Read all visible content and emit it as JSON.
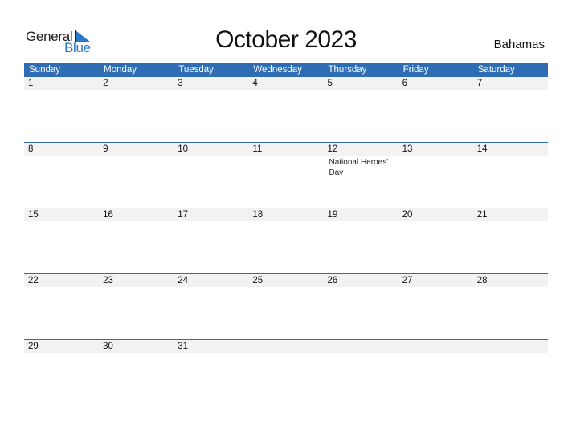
{
  "logo": {
    "part1": "General",
    "part2": "Blue"
  },
  "header": {
    "title": "October 2023",
    "country": "Bahamas"
  },
  "colors": {
    "accent": "#2e6db4",
    "date_strip": "#f2f2f2",
    "logo_blue": "#2a78c8"
  },
  "weekdays": [
    "Sunday",
    "Monday",
    "Tuesday",
    "Wednesday",
    "Thursday",
    "Friday",
    "Saturday"
  ],
  "weeks": [
    {
      "days": [
        {
          "date": "1",
          "event": ""
        },
        {
          "date": "2",
          "event": ""
        },
        {
          "date": "3",
          "event": ""
        },
        {
          "date": "4",
          "event": ""
        },
        {
          "date": "5",
          "event": ""
        },
        {
          "date": "6",
          "event": ""
        },
        {
          "date": "7",
          "event": ""
        }
      ]
    },
    {
      "days": [
        {
          "date": "8",
          "event": ""
        },
        {
          "date": "9",
          "event": ""
        },
        {
          "date": "10",
          "event": ""
        },
        {
          "date": "11",
          "event": ""
        },
        {
          "date": "12",
          "event": "National Heroes' Day"
        },
        {
          "date": "13",
          "event": ""
        },
        {
          "date": "14",
          "event": ""
        }
      ]
    },
    {
      "days": [
        {
          "date": "15",
          "event": ""
        },
        {
          "date": "16",
          "event": ""
        },
        {
          "date": "17",
          "event": ""
        },
        {
          "date": "18",
          "event": ""
        },
        {
          "date": "19",
          "event": ""
        },
        {
          "date": "20",
          "event": ""
        },
        {
          "date": "21",
          "event": ""
        }
      ]
    },
    {
      "days": [
        {
          "date": "22",
          "event": ""
        },
        {
          "date": "23",
          "event": ""
        },
        {
          "date": "24",
          "event": ""
        },
        {
          "date": "25",
          "event": ""
        },
        {
          "date": "26",
          "event": ""
        },
        {
          "date": "27",
          "event": ""
        },
        {
          "date": "28",
          "event": ""
        }
      ]
    },
    {
      "days": [
        {
          "date": "29",
          "event": ""
        },
        {
          "date": "30",
          "event": ""
        },
        {
          "date": "31",
          "event": ""
        },
        {
          "date": "",
          "event": ""
        },
        {
          "date": "",
          "event": ""
        },
        {
          "date": "",
          "event": ""
        },
        {
          "date": "",
          "event": ""
        }
      ]
    }
  ]
}
